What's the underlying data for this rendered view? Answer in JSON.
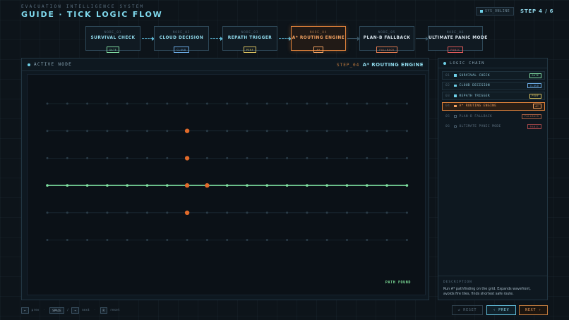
{
  "header": {
    "system_label": "EVACUATION INTELLIGENCE SYSTEM",
    "title": "GUIDE · TICK LOGIC FLOW",
    "status_badge": "SYS_ONLINE",
    "step_indicator": "STEP 4 / 6"
  },
  "flow": {
    "nodes": [
      {
        "id": "NODE_01",
        "name": "SURVIVAL CHECK",
        "tag": "GATE",
        "state": "done",
        "color": "#7fd8a0"
      },
      {
        "id": "NODE_02",
        "name": "CLOUD DECISION",
        "tag": "CLOUD",
        "state": "done",
        "color": "#6aa8e0"
      },
      {
        "id": "NODE_03",
        "name": "REPATH TRIGGER",
        "tag": "PERF",
        "state": "done",
        "color": "#d8c060"
      },
      {
        "id": "NODE_04",
        "name": "A* ROUTING ENGINE",
        "tag": "A*",
        "state": "active",
        "color": "#f0a060"
      },
      {
        "id": "NODE_05",
        "name": "PLAN-B FALLBACK",
        "tag": "FALLBACK",
        "state": "pending",
        "color": "#e07a50"
      },
      {
        "id": "NODE_06",
        "name": "ULTIMATE PANIC MODE",
        "tag": "PANIC",
        "state": "pending",
        "color": "#e05a5a"
      }
    ]
  },
  "main": {
    "header_label": "ACTIVE NODE",
    "step_id": "STEP_04",
    "engine_name": "A* ROUTING ENGINE",
    "path_status": "PATH FOUND",
    "grid": {
      "rows": 6,
      "cols": 19,
      "path_row": 3,
      "fire_cells": [
        [
          1,
          7
        ],
        [
          2,
          7
        ],
        [
          3,
          7
        ],
        [
          3,
          8
        ],
        [
          4,
          7
        ]
      ],
      "colors": {
        "dot": "#2a3c48",
        "path": "#7ee0a0",
        "fire": "#e06a2a",
        "line": "#1a2832"
      }
    }
  },
  "sidebar": {
    "title": "LOGIC CHAIN",
    "items": [
      {
        "num": "01",
        "name": "SURVIVAL CHECK",
        "tag": "GATE",
        "state": "done",
        "color": "#7fd8a0"
      },
      {
        "num": "02",
        "name": "CLOUD DECISION",
        "tag": "CLOUD",
        "state": "done",
        "color": "#6aa8e0"
      },
      {
        "num": "03",
        "name": "REPATH TRIGGER",
        "tag": "PERF",
        "state": "done",
        "color": "#d8c060"
      },
      {
        "num": "04",
        "name": "A* ROUTING ENGINE",
        "tag": "A*",
        "state": "active",
        "color": "#f0a060"
      },
      {
        "num": "05",
        "name": "PLAN-B FALLBACK",
        "tag": "FALLBACK",
        "state": "pending",
        "color": "#e07a50"
      },
      {
        "num": "06",
        "name": "ULTIMATE PANIC MODE",
        "tag": "PANIC",
        "state": "pending",
        "color": "#e05a5a"
      }
    ],
    "description_title": "DESCRIPTION",
    "description_text": "Run A* pathfinding on the grid. Expands wavefront, avoids fire tiles, finds shortest safe route."
  },
  "footer": {
    "prev_key": "←",
    "prev_label": "prev",
    "space_key": "SPACE",
    "slash": "/",
    "next_key": "→",
    "next_label": "next",
    "reset_key": "R",
    "reset_label": "reset",
    "reset_button": "↺ RESET",
    "prev_button": "‹ PREV",
    "next_button": "NEXT ›"
  }
}
